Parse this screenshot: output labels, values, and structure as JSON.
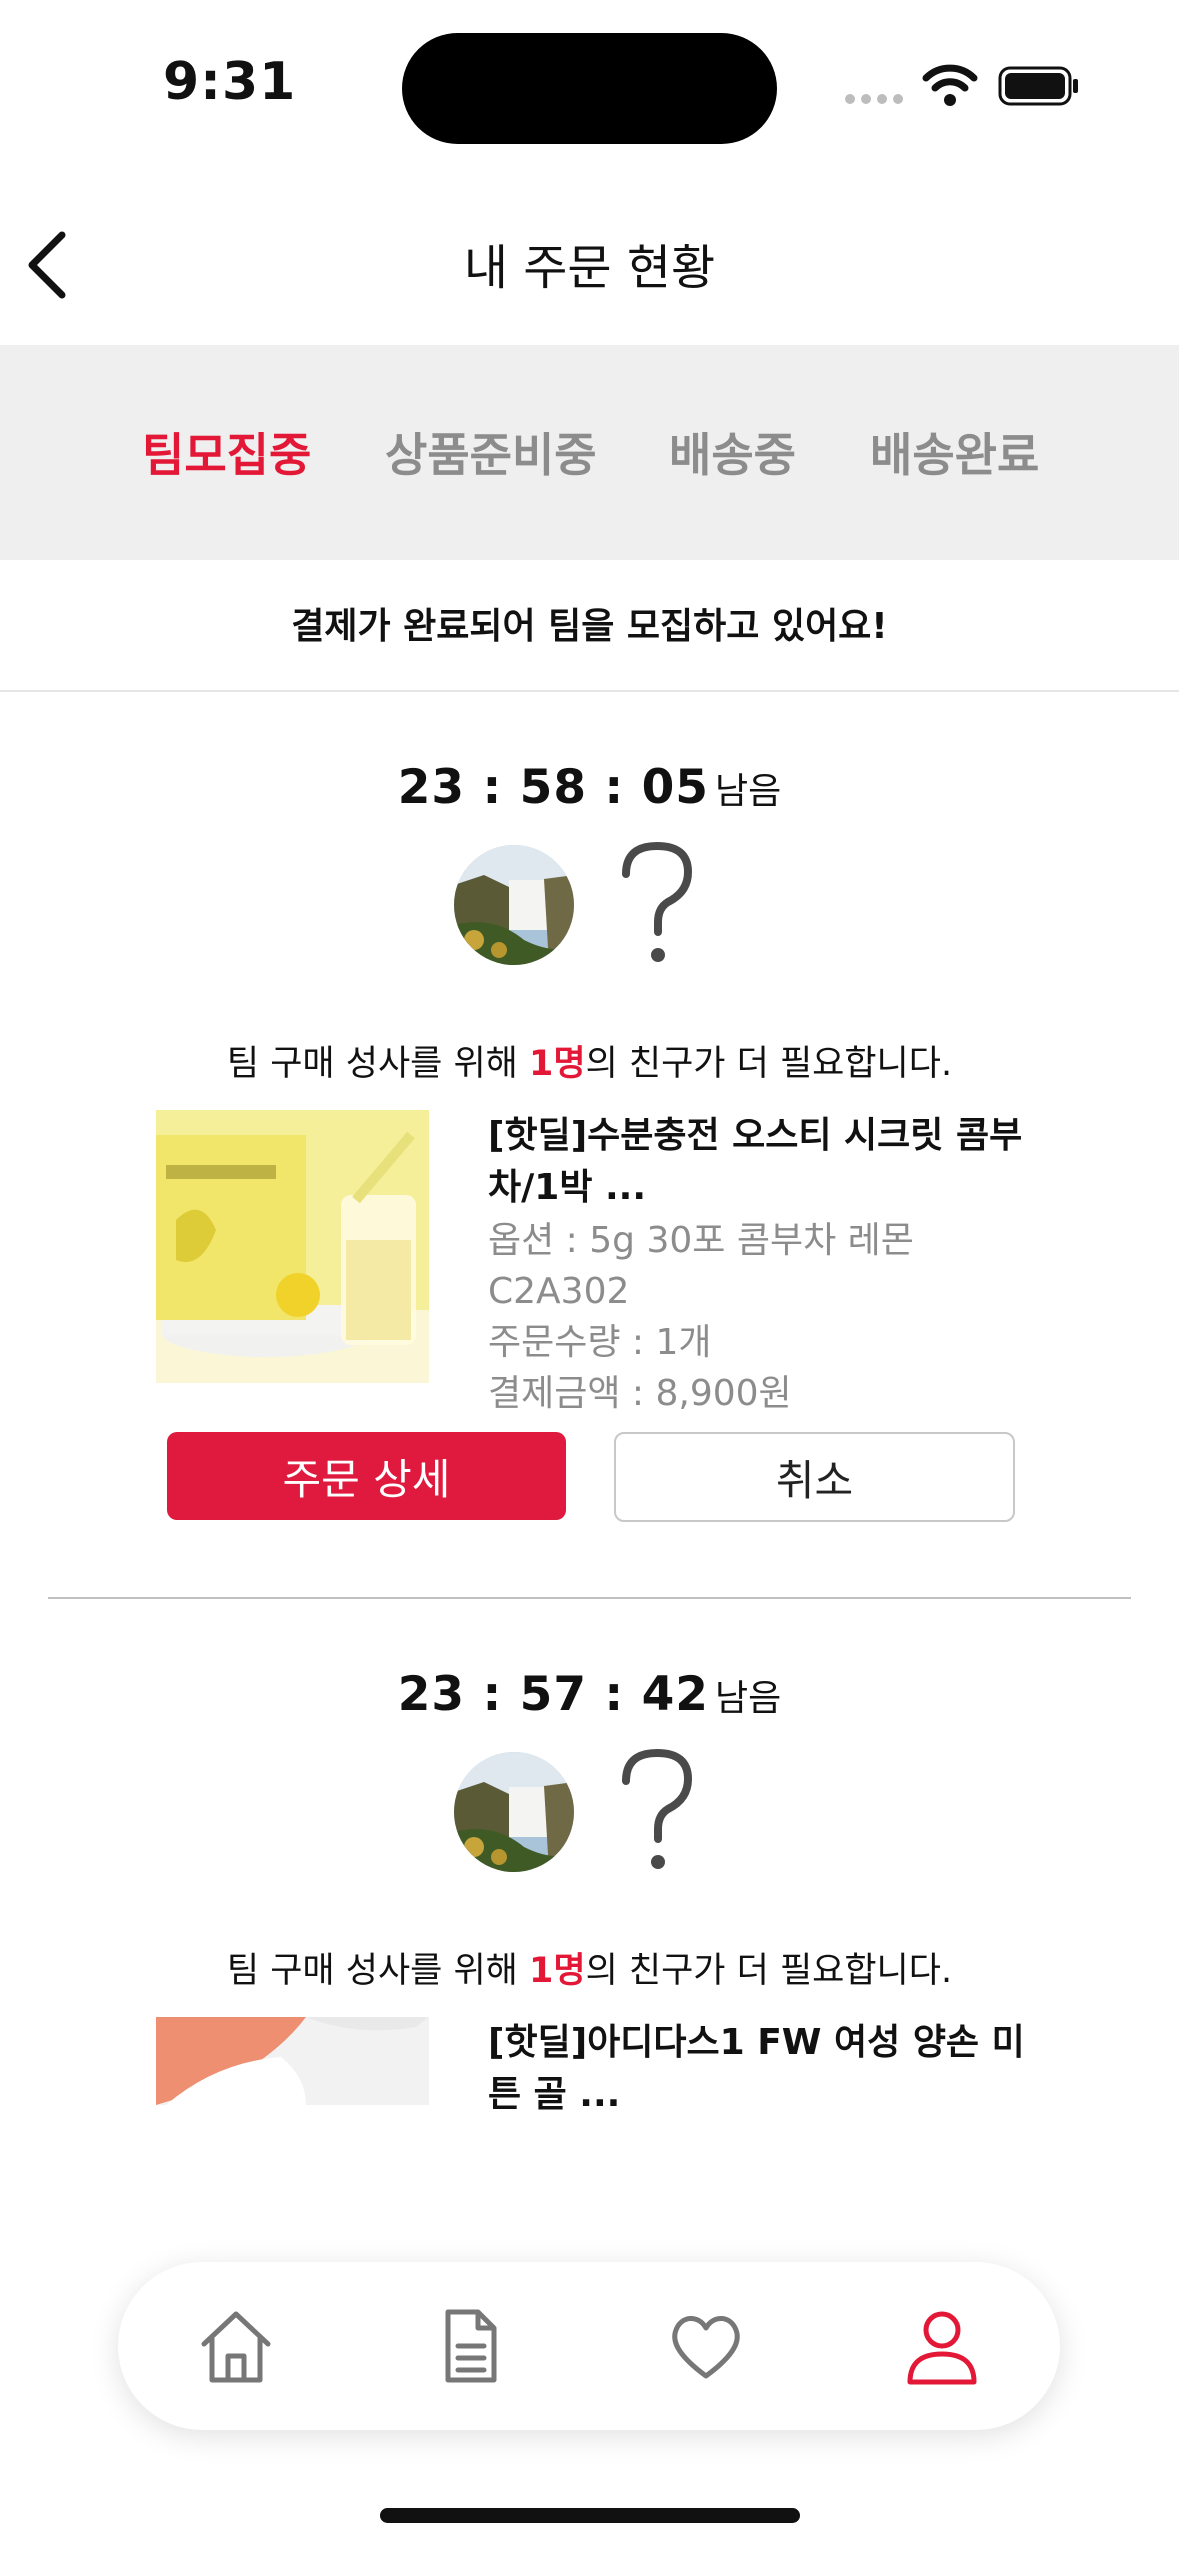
{
  "status_bar": {
    "time": "9:31"
  },
  "header": {
    "title": "내 주문 현황"
  },
  "tabs": [
    {
      "label": "팀모집중",
      "active": true
    },
    {
      "label": "상품준비중",
      "active": false
    },
    {
      "label": "배송중",
      "active": false
    },
    {
      "label": "배송완료",
      "active": false
    }
  ],
  "notice": "결제가 완료되어 팀을 모집하고 있어요!",
  "orders": [
    {
      "timer": "23 : 58 : 05",
      "remain_label": "남음",
      "need_prefix": "팀 구매 성사를 위해 ",
      "need_count": "1명",
      "need_suffix": "의 친구가 더 필요합니다.",
      "product_name": "[핫딜]수분충전 오스티 시크릿 콤부차/1박 ...",
      "option": "옵션 : 5g 30포 콤부차 레몬",
      "code": "C2A302",
      "quantity": "주문수량 : 1개",
      "price": "결제금액 : 8,900원",
      "detail_button": "주문 상세",
      "cancel_button": "취소"
    },
    {
      "timer": "23 : 57 : 42",
      "remain_label": "남음",
      "need_prefix": "팀 구매 성사를 위해 ",
      "need_count": "1명",
      "need_suffix": "의 친구가 더 필요합니다.",
      "product_name": "[핫딜]아디다스1 FW 여성 양손 미튼 골 ..."
    }
  ],
  "bottom_nav": [
    {
      "icon": "home-icon",
      "active": false
    },
    {
      "icon": "document-icon",
      "active": false
    },
    {
      "icon": "heart-icon",
      "active": false
    },
    {
      "icon": "user-icon",
      "active": true
    }
  ],
  "colors": {
    "accent": "#e31837",
    "button": "#df1a3e",
    "muted": "#8c8c8c",
    "tab_bg": "#efefef"
  }
}
